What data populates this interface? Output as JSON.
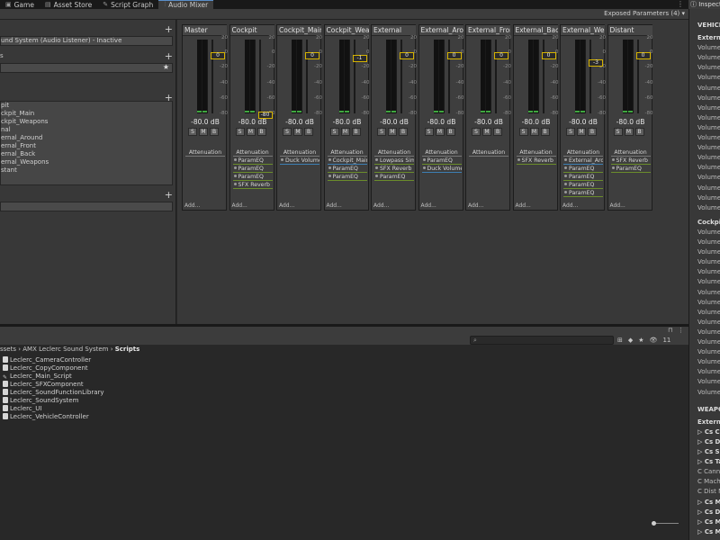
{
  "tabs": [
    {
      "icon": "game-icon",
      "label": "Game"
    },
    {
      "icon": "asset-store-icon",
      "label": "Asset Store"
    },
    {
      "icon": "script-graph-icon",
      "label": "Script Graph"
    },
    {
      "icon": "audio-mixer-icon",
      "label": "Audio Mixer"
    }
  ],
  "mixer": {
    "exposed_params": "Exposed Parameters (4) ▾"
  },
  "left_panel": {
    "mixers_row": "und System   (Audio Listener) - Inactive",
    "snapshots_header": "s",
    "snapshot_row": "",
    "groups_header": "",
    "groups": [
      "pit",
      "ckpit_Main",
      "ckpit_Weapons",
      "nal",
      "ernal_Around",
      "ernal_Front",
      "ernal_Back",
      "ernal_Weapons",
      "stant"
    ],
    "views_header": ""
  },
  "strips": [
    {
      "name": "Master",
      "db": "-80.0 dB",
      "handle": "0",
      "handle_pos": 0,
      "effects": [
        {
          "label": "Attenuation",
          "kind": "att"
        }
      ]
    },
    {
      "name": "Cockpit",
      "db": "-80.0 dB",
      "handle": "-80",
      "handle_pos": 1,
      "effects": [
        {
          "label": "Attenuation",
          "kind": "att"
        },
        {
          "label": "ParamEQ",
          "kind": "fx"
        },
        {
          "label": "ParamEQ",
          "kind": "fx"
        },
        {
          "label": "ParamEQ",
          "kind": "fx"
        },
        {
          "label": "SFX Reverb",
          "kind": "fx"
        }
      ]
    },
    {
      "name": "Cockpit_Main",
      "db": "-80.0 dB",
      "handle": "0",
      "handle_pos": 0,
      "effects": [
        {
          "label": "Attenuation",
          "kind": "att"
        },
        {
          "label": "Duck Volume",
          "kind": "blue"
        }
      ]
    },
    {
      "name": "Cockpit_Weapons",
      "db": "-80.0 dB",
      "handle": "-1",
      "handle_pos": 0.05,
      "effects": [
        {
          "label": "Attenuation",
          "kind": "att"
        },
        {
          "label": "Cockpit_Main",
          "kind": "blue"
        },
        {
          "label": "ParamEQ",
          "kind": "fx"
        },
        {
          "label": "ParamEQ",
          "kind": "fx"
        }
      ]
    },
    {
      "name": "External",
      "db": "-80.0 dB",
      "handle": "0",
      "handle_pos": 0,
      "effects": [
        {
          "label": "Attenuation",
          "kind": "att"
        },
        {
          "label": "Lowpass Sim",
          "kind": "fx"
        },
        {
          "label": "SFX Reverb",
          "kind": "fx"
        },
        {
          "label": "ParamEQ",
          "kind": "fx"
        }
      ]
    },
    {
      "name": "External_Around",
      "db": "-80.0 dB",
      "handle": "0",
      "handle_pos": 0,
      "effects": [
        {
          "label": "Attenuation",
          "kind": "att"
        },
        {
          "label": "ParamEQ",
          "kind": "fx"
        },
        {
          "label": "Duck Volume",
          "kind": "blue"
        }
      ]
    },
    {
      "name": "External_Front",
      "db": "-80.0 dB",
      "handle": "0",
      "handle_pos": 0,
      "effects": [
        {
          "label": "Attenuation",
          "kind": "att"
        }
      ]
    },
    {
      "name": "External_Back",
      "db": "-80.0 dB",
      "handle": "0",
      "handle_pos": 0,
      "effects": [
        {
          "label": "Attenuation",
          "kind": "att"
        },
        {
          "label": "SFX Reverb",
          "kind": "fx"
        }
      ]
    },
    {
      "name": "External_Weapons",
      "db": "-80.0 dB",
      "handle": "-3",
      "handle_pos": 0.12,
      "effects": [
        {
          "label": "Attenuation",
          "kind": "att"
        },
        {
          "label": "External_Arou",
          "kind": "blue"
        },
        {
          "label": "ParamEQ",
          "kind": "fx"
        },
        {
          "label": "ParamEQ",
          "kind": "fx"
        },
        {
          "label": "ParamEQ",
          "kind": "fx"
        },
        {
          "label": "ParamEQ",
          "kind": "fx"
        }
      ]
    },
    {
      "name": "Distant",
      "db": "-80.0 dB",
      "handle": "0",
      "handle_pos": 0,
      "effects": [
        {
          "label": "Attenuation",
          "kind": "att"
        },
        {
          "label": "SFX Reverb",
          "kind": "fx"
        },
        {
          "label": "ParamEQ",
          "kind": "fx"
        }
      ]
    }
  ],
  "strip_labels": {
    "ticks": [
      "20",
      "0",
      "-20",
      "-40",
      "-60",
      "-80"
    ],
    "solo": "S",
    "mute": "M",
    "bypass": "B",
    "add": "Add..."
  },
  "project": {
    "breadcrumb_parts": [
      "ssets",
      "AMX Leclerc Sound System"
    ],
    "breadcrumb_current": "Scripts",
    "files": [
      {
        "name": "Leclerc_CameraController",
        "icon": "script-icon"
      },
      {
        "name": "Leclerc_CopyComponent",
        "icon": "script-icon"
      },
      {
        "name": "Leclerc_Main_Script",
        "icon": "wrench-script-icon"
      },
      {
        "name": "Leclerc_SFXComponent",
        "icon": "script-icon"
      },
      {
        "name": "Leclerc_SoundFunctionLibrary",
        "icon": "script-icon"
      },
      {
        "name": "Leclerc_SoundSystem",
        "icon": "script-icon"
      },
      {
        "name": "Leclerc_UI",
        "icon": "script-icon"
      },
      {
        "name": "Leclerc_VehicleController",
        "icon": "script-icon"
      }
    ],
    "hidden_count": "11"
  },
  "inspector": {
    "tab": "Inspect",
    "lines": [
      {
        "text": "VEHICL",
        "bold": true
      },
      {
        "text": "Externa",
        "bold": true
      },
      {
        "text": "Volume_",
        "bold": false
      },
      {
        "text": "Volume_",
        "bold": false
      },
      {
        "text": "Volume_",
        "bold": false
      },
      {
        "text": "Volume_",
        "bold": false
      },
      {
        "text": "Volume_",
        "bold": false
      },
      {
        "text": "Volume_",
        "bold": false
      },
      {
        "text": "Volume_",
        "bold": false
      },
      {
        "text": "Volume_",
        "bold": false
      },
      {
        "text": "Volume_",
        "bold": false
      },
      {
        "text": "Volume_",
        "bold": false
      },
      {
        "text": "Volume_",
        "bold": false
      },
      {
        "text": "Volume_",
        "bold": false
      },
      {
        "text": "Volume_",
        "bold": false
      },
      {
        "text": "Volume_",
        "bold": false
      },
      {
        "text": "Volume_",
        "bold": false
      },
      {
        "text": "Volume_",
        "bold": false
      },
      {
        "text": "Volume_",
        "bold": false
      },
      {
        "text": "Cockpit",
        "bold": true
      },
      {
        "text": "Volume_",
        "bold": false
      },
      {
        "text": "Volume_",
        "bold": false
      },
      {
        "text": "Volume_",
        "bold": false
      },
      {
        "text": "Volume_",
        "bold": false
      },
      {
        "text": "Volume_",
        "bold": false
      },
      {
        "text": "Volume_",
        "bold": false
      },
      {
        "text": "Volume_",
        "bold": false
      },
      {
        "text": "Volume_",
        "bold": false
      },
      {
        "text": "Volume_",
        "bold": false
      },
      {
        "text": "Volume_",
        "bold": false
      },
      {
        "text": "Volume_",
        "bold": false
      },
      {
        "text": "Volume_",
        "bold": false
      },
      {
        "text": "Volume_",
        "bold": false
      },
      {
        "text": "Volume_",
        "bold": false
      },
      {
        "text": "Volume_",
        "bold": false
      },
      {
        "text": "Volume_",
        "bold": false
      },
      {
        "text": "Volume_",
        "bold": false
      },
      {
        "text": "WEAPO",
        "bold": true
      },
      {
        "text": "Externa",
        "bold": true
      },
      {
        "text": "▷ Cs Cann",
        "bold": true
      },
      {
        "text": "▷ Cs Dist",
        "bold": true
      },
      {
        "text": "▷ Cs Shot",
        "bold": true
      },
      {
        "text": "▷ Cs Tail",
        "bold": true
      },
      {
        "text": "C Cann",
        "bold": false
      },
      {
        "text": "C Mach",
        "bold": false
      },
      {
        "text": "C Dist M",
        "bold": false
      },
      {
        "text": "▷ Cs Mac",
        "bold": true
      },
      {
        "text": "▷ Cs Dist",
        "bold": true
      },
      {
        "text": "▷ Cs Mac",
        "bold": true
      },
      {
        "text": "▷ Cs Mac",
        "bold": true
      }
    ]
  }
}
